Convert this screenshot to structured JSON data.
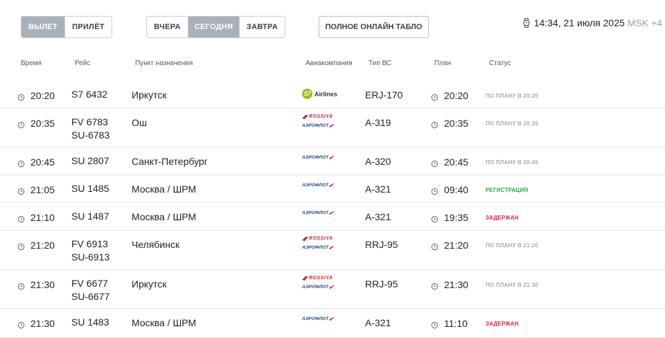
{
  "direction_tabs": [
    {
      "label": "ВЫЛЕТ",
      "active": true
    },
    {
      "label": "ПРИЛЁТ",
      "active": false
    }
  ],
  "day_tabs": [
    {
      "label": "ВЧЕРА",
      "active": false
    },
    {
      "label": "СЕГОДНЯ",
      "active": true
    },
    {
      "label": "ЗАВТРА",
      "active": false
    }
  ],
  "board_button": "ПОЛНОЕ ОНЛАЙН ТАБЛО",
  "clock": {
    "time": "14:34, 21 июля 2025",
    "tz": "MSK +4",
    "icon": "watch-icon"
  },
  "columns": {
    "time": "Время",
    "flight": "Рейс",
    "destination": "Пункт назначения",
    "airline": "Авиакомпания",
    "aircraft": "Тип ВС",
    "plan": "План",
    "status": "Статус"
  },
  "colors": {
    "active_tab": "#a7b1bc",
    "status_plan": "#a4aab0",
    "status_registration": "#2aa84a",
    "status_delayed": "#d8263a"
  },
  "flights": [
    {
      "time": "20:20",
      "flights": [
        "S7 6432"
      ],
      "destination": "Иркутск",
      "airlines": [
        {
          "logo": "s7",
          "text": "Airlines"
        }
      ],
      "aircraft": "ERJ-170",
      "plan": "20:20",
      "status": "ПО ПЛАНУ В 20:20",
      "status_type": "plan"
    },
    {
      "time": "20:35",
      "flights": [
        "FV 6783",
        "SU-6783"
      ],
      "destination": "Ош",
      "airlines": [
        {
          "logo": "rossiya",
          "text": "ROSSIYA"
        },
        {
          "logo": "aeroflot",
          "text": "АЭРОФЛОТ"
        }
      ],
      "aircraft": "A-319",
      "plan": "20:35",
      "status": "ПО ПЛАНУ В 20:35",
      "status_type": "plan"
    },
    {
      "time": "20:45",
      "flights": [
        "SU 2807"
      ],
      "destination": "Санкт-Петербург",
      "airlines": [
        {
          "logo": "aeroflot",
          "text": "АЭРОФЛОТ"
        }
      ],
      "aircraft": "A-320",
      "plan": "20:45",
      "status": "ПО ПЛАНУ В 20:45",
      "status_type": "plan"
    },
    {
      "time": "21:05",
      "flights": [
        "SU 1485"
      ],
      "destination": "Москва / ШРМ",
      "airlines": [
        {
          "logo": "aeroflot",
          "text": "АЭРОФЛОТ"
        }
      ],
      "aircraft": "A-321",
      "plan": "09:40",
      "status": "РЕГИСТРАЦИЯ",
      "status_type": "reg"
    },
    {
      "time": "21:10",
      "flights": [
        "SU 1487"
      ],
      "destination": "Москва / ШРМ",
      "airlines": [
        {
          "logo": "aeroflot",
          "text": "АЭРОФЛОТ"
        }
      ],
      "aircraft": "A-321",
      "plan": "19:35",
      "status": "ЗАДЕРЖАН",
      "status_type": "delay"
    },
    {
      "time": "21:20",
      "flights": [
        "FV 6913",
        "SU-6913"
      ],
      "destination": "Челябинск",
      "airlines": [
        {
          "logo": "rossiya",
          "text": "ROSSIYA"
        },
        {
          "logo": "aeroflot",
          "text": "АЭРОФЛОТ"
        }
      ],
      "aircraft": "RRJ-95",
      "plan": "21:20",
      "status": "ПО ПЛАНУ В 21:20",
      "status_type": "plan"
    },
    {
      "time": "21:30",
      "flights": [
        "FV 6677",
        "SU-6677"
      ],
      "destination": "Иркутск",
      "airlines": [
        {
          "logo": "rossiya",
          "text": "ROSSIYA"
        },
        {
          "logo": "aeroflot",
          "text": "АЭРОФЛОТ"
        }
      ],
      "aircraft": "RRJ-95",
      "plan": "21:30",
      "status": "ПО ПЛАНУ В 21:30",
      "status_type": "plan"
    },
    {
      "time": "21:30",
      "flights": [
        "SU 1483"
      ],
      "destination": "Москва / ШРМ",
      "airlines": [
        {
          "logo": "aeroflot",
          "text": "АЭРОФЛОТ"
        }
      ],
      "aircraft": "A-321",
      "plan": "11:10",
      "status": "ЗАДЕРЖАН",
      "status_type": "delay"
    }
  ]
}
